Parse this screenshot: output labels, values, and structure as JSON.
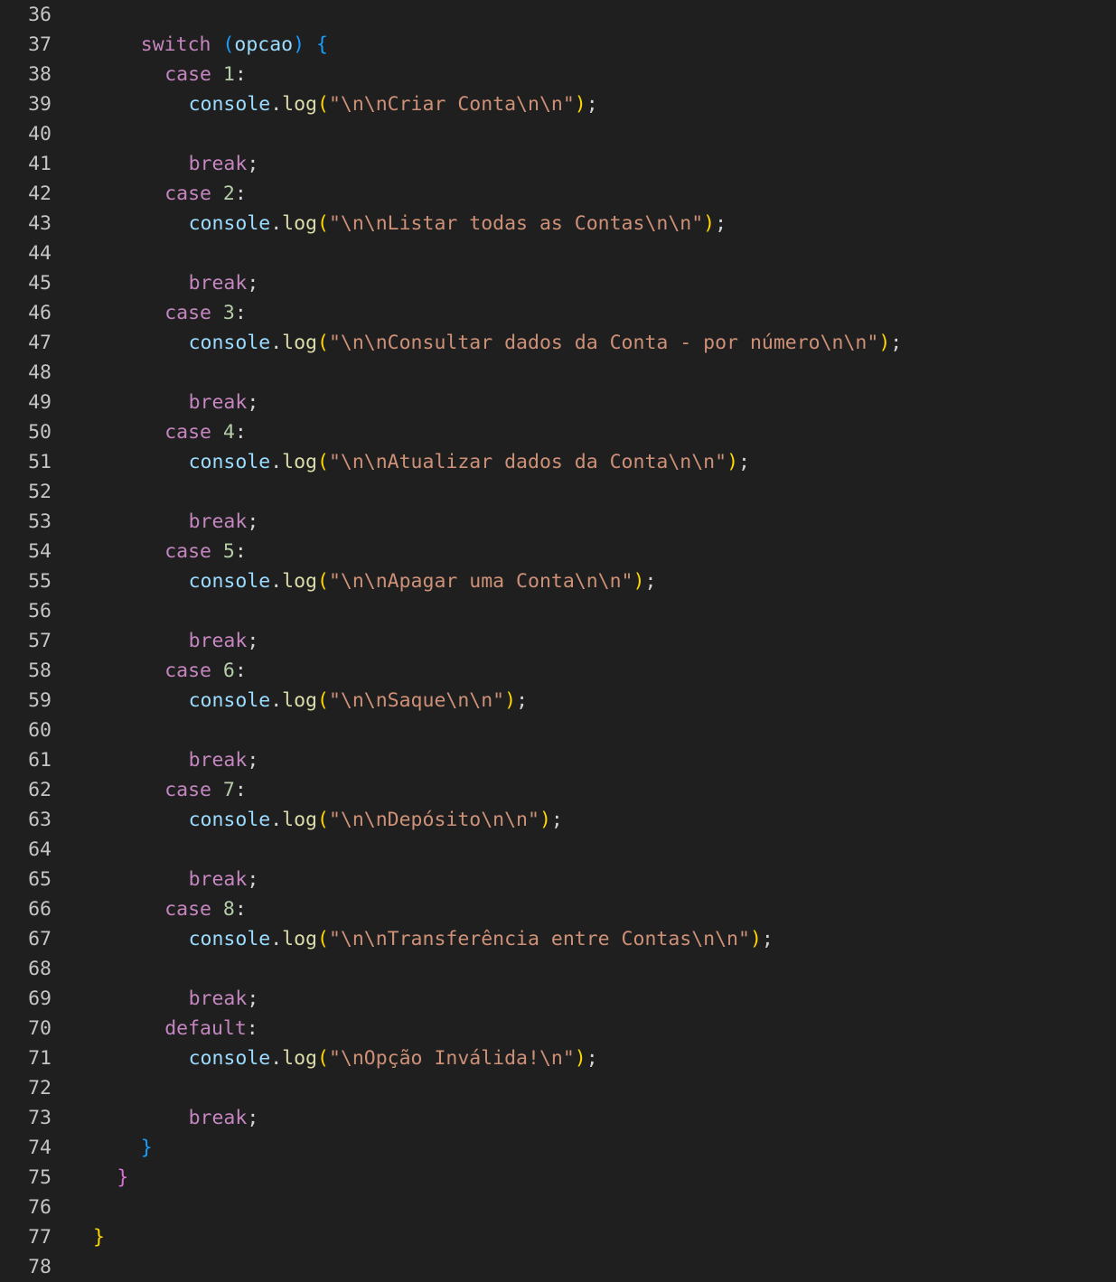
{
  "editor": {
    "language": "typescript",
    "theme": "dark",
    "lines": [
      {
        "n": "36",
        "indent": 0,
        "tokens": []
      },
      {
        "n": "37",
        "indent": 4,
        "tokens": [
          [
            "kw",
            "switch"
          ],
          [
            "pun",
            " "
          ],
          [
            "br3",
            "("
          ],
          [
            "var",
            "opcao"
          ],
          [
            "br3",
            ")"
          ],
          [
            "pun",
            " "
          ],
          [
            "br3",
            "{"
          ]
        ]
      },
      {
        "n": "38",
        "indent": 6,
        "tokens": [
          [
            "kw",
            "case"
          ],
          [
            "pun",
            " "
          ],
          [
            "num",
            "1"
          ],
          [
            "pun",
            ":"
          ]
        ]
      },
      {
        "n": "39",
        "indent": 8,
        "tokens": [
          [
            "var",
            "console"
          ],
          [
            "pun",
            "."
          ],
          [
            "fn",
            "log"
          ],
          [
            "br1",
            "("
          ],
          [
            "str",
            "\"\\n\\nCriar Conta\\n\\n\""
          ],
          [
            "br1",
            ")"
          ],
          [
            "pun",
            ";"
          ]
        ]
      },
      {
        "n": "40",
        "indent": 0,
        "tokens": []
      },
      {
        "n": "41",
        "indent": 8,
        "tokens": [
          [
            "kw",
            "break"
          ],
          [
            "pun",
            ";"
          ]
        ]
      },
      {
        "n": "42",
        "indent": 6,
        "tokens": [
          [
            "kw",
            "case"
          ],
          [
            "pun",
            " "
          ],
          [
            "num",
            "2"
          ],
          [
            "pun",
            ":"
          ]
        ]
      },
      {
        "n": "43",
        "indent": 8,
        "tokens": [
          [
            "var",
            "console"
          ],
          [
            "pun",
            "."
          ],
          [
            "fn",
            "log"
          ],
          [
            "br1",
            "("
          ],
          [
            "str",
            "\"\\n\\nListar todas as Contas\\n\\n\""
          ],
          [
            "br1",
            ")"
          ],
          [
            "pun",
            ";"
          ]
        ]
      },
      {
        "n": "44",
        "indent": 0,
        "tokens": []
      },
      {
        "n": "45",
        "indent": 8,
        "tokens": [
          [
            "kw",
            "break"
          ],
          [
            "pun",
            ";"
          ]
        ]
      },
      {
        "n": "46",
        "indent": 6,
        "tokens": [
          [
            "kw",
            "case"
          ],
          [
            "pun",
            " "
          ],
          [
            "num",
            "3"
          ],
          [
            "pun",
            ":"
          ]
        ]
      },
      {
        "n": "47",
        "indent": 8,
        "tokens": [
          [
            "var",
            "console"
          ],
          [
            "pun",
            "."
          ],
          [
            "fn",
            "log"
          ],
          [
            "br1",
            "("
          ],
          [
            "str",
            "\"\\n\\nConsultar dados da Conta - por número\\n\\n\""
          ],
          [
            "br1",
            ")"
          ],
          [
            "pun",
            ";"
          ]
        ]
      },
      {
        "n": "48",
        "indent": 0,
        "tokens": []
      },
      {
        "n": "49",
        "indent": 8,
        "tokens": [
          [
            "kw",
            "break"
          ],
          [
            "pun",
            ";"
          ]
        ]
      },
      {
        "n": "50",
        "indent": 6,
        "tokens": [
          [
            "kw",
            "case"
          ],
          [
            "pun",
            " "
          ],
          [
            "num",
            "4"
          ],
          [
            "pun",
            ":"
          ]
        ]
      },
      {
        "n": "51",
        "indent": 8,
        "tokens": [
          [
            "var",
            "console"
          ],
          [
            "pun",
            "."
          ],
          [
            "fn",
            "log"
          ],
          [
            "br1",
            "("
          ],
          [
            "str",
            "\"\\n\\nAtualizar dados da Conta\\n\\n\""
          ],
          [
            "br1",
            ")"
          ],
          [
            "pun",
            ";"
          ]
        ]
      },
      {
        "n": "52",
        "indent": 0,
        "tokens": []
      },
      {
        "n": "53",
        "indent": 8,
        "tokens": [
          [
            "kw",
            "break"
          ],
          [
            "pun",
            ";"
          ]
        ]
      },
      {
        "n": "54",
        "indent": 6,
        "tokens": [
          [
            "kw",
            "case"
          ],
          [
            "pun",
            " "
          ],
          [
            "num",
            "5"
          ],
          [
            "pun",
            ":"
          ]
        ]
      },
      {
        "n": "55",
        "indent": 8,
        "tokens": [
          [
            "var",
            "console"
          ],
          [
            "pun",
            "."
          ],
          [
            "fn",
            "log"
          ],
          [
            "br1",
            "("
          ],
          [
            "str",
            "\"\\n\\nApagar uma Conta\\n\\n\""
          ],
          [
            "br1",
            ")"
          ],
          [
            "pun",
            ";"
          ]
        ]
      },
      {
        "n": "56",
        "indent": 0,
        "tokens": []
      },
      {
        "n": "57",
        "indent": 8,
        "tokens": [
          [
            "kw",
            "break"
          ],
          [
            "pun",
            ";"
          ]
        ]
      },
      {
        "n": "58",
        "indent": 6,
        "tokens": [
          [
            "kw",
            "case"
          ],
          [
            "pun",
            " "
          ],
          [
            "num",
            "6"
          ],
          [
            "pun",
            ":"
          ]
        ]
      },
      {
        "n": "59",
        "indent": 8,
        "tokens": [
          [
            "var",
            "console"
          ],
          [
            "pun",
            "."
          ],
          [
            "fn",
            "log"
          ],
          [
            "br1",
            "("
          ],
          [
            "str",
            "\"\\n\\nSaque\\n\\n\""
          ],
          [
            "br1",
            ")"
          ],
          [
            "pun",
            ";"
          ]
        ]
      },
      {
        "n": "60",
        "indent": 0,
        "tokens": []
      },
      {
        "n": "61",
        "indent": 8,
        "tokens": [
          [
            "kw",
            "break"
          ],
          [
            "pun",
            ";"
          ]
        ]
      },
      {
        "n": "62",
        "indent": 6,
        "tokens": [
          [
            "kw",
            "case"
          ],
          [
            "pun",
            " "
          ],
          [
            "num",
            "7"
          ],
          [
            "pun",
            ":"
          ]
        ]
      },
      {
        "n": "63",
        "indent": 8,
        "tokens": [
          [
            "var",
            "console"
          ],
          [
            "pun",
            "."
          ],
          [
            "fn",
            "log"
          ],
          [
            "br1",
            "("
          ],
          [
            "str",
            "\"\\n\\nDepósito\\n\\n\""
          ],
          [
            "br1",
            ")"
          ],
          [
            "pun",
            ";"
          ]
        ]
      },
      {
        "n": "64",
        "indent": 0,
        "tokens": []
      },
      {
        "n": "65",
        "indent": 8,
        "tokens": [
          [
            "kw",
            "break"
          ],
          [
            "pun",
            ";"
          ]
        ]
      },
      {
        "n": "66",
        "indent": 6,
        "tokens": [
          [
            "kw",
            "case"
          ],
          [
            "pun",
            " "
          ],
          [
            "num",
            "8"
          ],
          [
            "pun",
            ":"
          ]
        ]
      },
      {
        "n": "67",
        "indent": 8,
        "tokens": [
          [
            "var",
            "console"
          ],
          [
            "pun",
            "."
          ],
          [
            "fn",
            "log"
          ],
          [
            "br1",
            "("
          ],
          [
            "str",
            "\"\\n\\nTransferência entre Contas\\n\\n\""
          ],
          [
            "br1",
            ")"
          ],
          [
            "pun",
            ";"
          ]
        ]
      },
      {
        "n": "68",
        "indent": 0,
        "tokens": []
      },
      {
        "n": "69",
        "indent": 8,
        "tokens": [
          [
            "kw",
            "break"
          ],
          [
            "pun",
            ";"
          ]
        ]
      },
      {
        "n": "70",
        "indent": 6,
        "tokens": [
          [
            "kw",
            "default"
          ],
          [
            "pun",
            ":"
          ]
        ]
      },
      {
        "n": "71",
        "indent": 8,
        "tokens": [
          [
            "var",
            "console"
          ],
          [
            "pun",
            "."
          ],
          [
            "fn",
            "log"
          ],
          [
            "br1",
            "("
          ],
          [
            "str",
            "\"\\nOpção Inválida!\\n\""
          ],
          [
            "br1",
            ")"
          ],
          [
            "pun",
            ";"
          ]
        ]
      },
      {
        "n": "72",
        "indent": 0,
        "tokens": []
      },
      {
        "n": "73",
        "indent": 8,
        "tokens": [
          [
            "kw",
            "break"
          ],
          [
            "pun",
            ";"
          ]
        ]
      },
      {
        "n": "74",
        "indent": 4,
        "tokens": [
          [
            "br3",
            "}"
          ]
        ]
      },
      {
        "n": "75",
        "indent": 2,
        "tokens": [
          [
            "br2",
            "}"
          ]
        ]
      },
      {
        "n": "76",
        "indent": 0,
        "tokens": []
      },
      {
        "n": "77",
        "indent": 0,
        "tokens": [
          [
            "br1",
            "}"
          ]
        ]
      },
      {
        "n": "78",
        "indent": 0,
        "tokens": []
      }
    ],
    "colors": {
      "background": "#1f1f1f",
      "line_number": "#c5c5c5",
      "keyword": "#c586c0",
      "function": "#dcdcaa",
      "variable": "#9cdcfe",
      "string": "#ce9178",
      "number": "#b5cea8",
      "bracket_gold": "#ffd700",
      "bracket_orchid": "#da70d6",
      "bracket_blue": "#179fff"
    }
  }
}
